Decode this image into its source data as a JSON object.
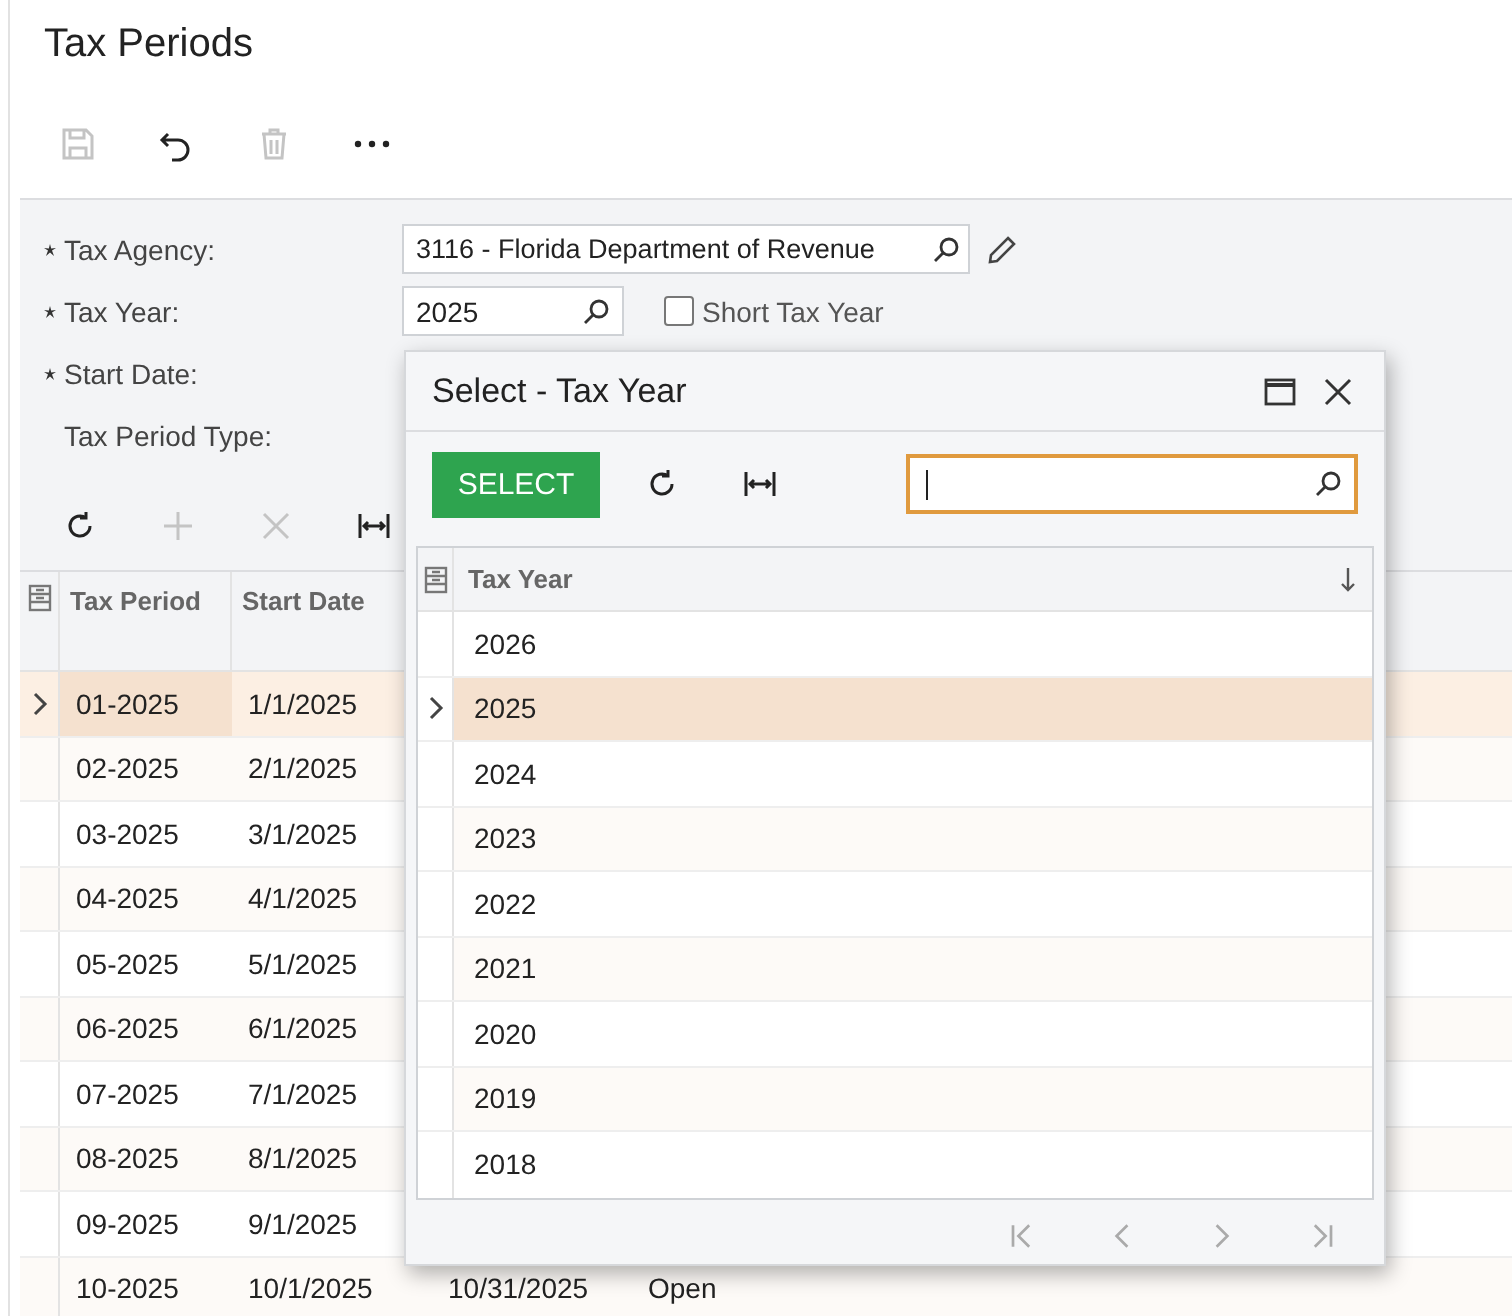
{
  "page": {
    "title": "Tax Periods"
  },
  "toolbar": [
    {
      "kind": "save",
      "disabled": true
    },
    {
      "kind": "undo",
      "disabled": false
    },
    {
      "kind": "delete",
      "disabled": true
    },
    {
      "kind": "more",
      "disabled": false
    }
  ],
  "form": {
    "fields": [
      {
        "label": "Tax Agency:",
        "required": true,
        "kind": "lookup_edit",
        "value": "3116 - Florida Department of Revenue"
      },
      {
        "label": "Tax Year:",
        "required": true,
        "kind": "lookup",
        "value": "2025",
        "checkbox": {
          "label": "Short Tax Year",
          "checked": false
        }
      },
      {
        "label": "Start Date:",
        "required": true,
        "kind": "hidden"
      },
      {
        "label": "Tax Period Type:",
        "required": false,
        "kind": "hidden"
      }
    ]
  },
  "grid": {
    "toolbar": [
      {
        "kind": "refresh",
        "disabled": false
      },
      {
        "kind": "add",
        "disabled": true
      },
      {
        "kind": "delete",
        "disabled": true
      },
      {
        "kind": "fit",
        "disabled": false
      }
    ],
    "columns": [
      "Tax Period",
      "Start Date"
    ],
    "rows": [
      {
        "cells": [
          "01-2025",
          "1/1/2025"
        ],
        "selected": true
      },
      {
        "cells": [
          "02-2025",
          "2/1/2025"
        ],
        "selected": false
      },
      {
        "cells": [
          "03-2025",
          "3/1/2025"
        ],
        "selected": false
      },
      {
        "cells": [
          "04-2025",
          "4/1/2025"
        ],
        "selected": false
      },
      {
        "cells": [
          "05-2025",
          "5/1/2025"
        ],
        "selected": false
      },
      {
        "cells": [
          "06-2025",
          "6/1/2025"
        ],
        "selected": false
      },
      {
        "cells": [
          "07-2025",
          "7/1/2025"
        ],
        "selected": false
      },
      {
        "cells": [
          "08-2025",
          "8/1/2025"
        ],
        "selected": false
      },
      {
        "cells": [
          "09-2025",
          "9/1/2025"
        ],
        "selected": false
      },
      {
        "cells": [
          "10-2025",
          "10/1/2025",
          "10/31/2025",
          "Open"
        ],
        "selected": false
      }
    ]
  },
  "dialog": {
    "title": "Select - Tax Year",
    "select_button": "SELECT",
    "search": {
      "focused": true
    },
    "column": "Tax Year",
    "rows": [
      {
        "value": "2026",
        "selected": false
      },
      {
        "value": "2025",
        "selected": true
      },
      {
        "value": "2024",
        "selected": false
      },
      {
        "value": "2023",
        "selected": false
      },
      {
        "value": "2022",
        "selected": false
      },
      {
        "value": "2021",
        "selected": false
      },
      {
        "value": "2020",
        "selected": false
      },
      {
        "value": "2019",
        "selected": false
      },
      {
        "value": "2018",
        "selected": false
      }
    ],
    "pager": [
      {
        "kind": "first",
        "disabled": true
      },
      {
        "kind": "prev",
        "disabled": true
      },
      {
        "kind": "next",
        "disabled": true
      },
      {
        "kind": "last",
        "disabled": true
      }
    ]
  }
}
